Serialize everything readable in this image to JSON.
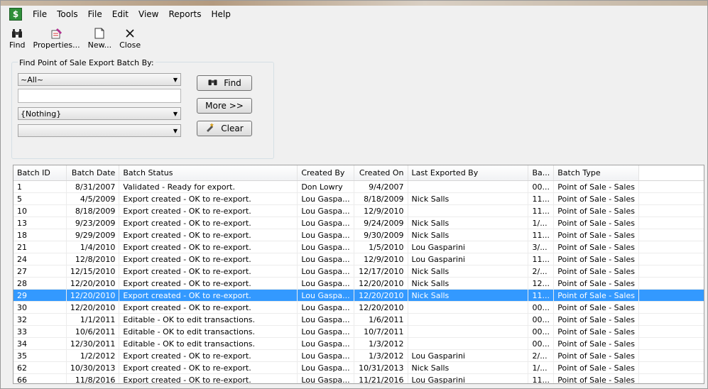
{
  "menu": [
    "File",
    "Tools",
    "File",
    "Edit",
    "View",
    "Reports",
    "Help"
  ],
  "toolbar": {
    "find": "Find",
    "properties": "Properties...",
    "new": "New...",
    "close": "Close"
  },
  "search": {
    "group_title": "Find Point of Sale Export Batch By:",
    "field1_value": "~All~",
    "text_value": "",
    "field2_value": "{Nothing}",
    "field3_value": "",
    "find_label": "Find",
    "more_label": "More >>",
    "clear_label": "Clear"
  },
  "table": {
    "columns": [
      "Batch ID",
      "Batch Date",
      "Batch Status",
      "Created By",
      "Created On",
      "Last Exported By",
      "Ba...",
      "Batch Type"
    ],
    "selected_index": 9,
    "rows": [
      [
        "1",
        "8/31/2007",
        "Validated - Ready for export.",
        "Don Lowry",
        "9/4/2007",
        "",
        "00...",
        "Point of Sale - Sales"
      ],
      [
        "5",
        "4/5/2009",
        "Export created - OK to re-export.",
        "Lou Gaspa...",
        "8/18/2009",
        "Nick Salls",
        "11...",
        "Point of Sale - Sales"
      ],
      [
        "10",
        "8/18/2009",
        "Export created - OK to re-export.",
        "Lou Gaspa...",
        "12/9/2010",
        "",
        "11...",
        "Point of Sale - Sales"
      ],
      [
        "13",
        "9/23/2009",
        "Export created - OK to re-export.",
        "Lou Gaspa...",
        "9/24/2009",
        "Nick Salls",
        "1/...",
        "Point of Sale - Sales"
      ],
      [
        "18",
        "9/29/2009",
        "Export created - OK to re-export.",
        "Lou Gaspa...",
        "9/30/2009",
        "Nick Salls",
        "11...",
        "Point of Sale - Sales"
      ],
      [
        "21",
        "1/4/2010",
        "Export created - OK to re-export.",
        "Lou Gaspa...",
        "1/5/2010",
        "Lou Gasparini",
        "3/...",
        "Point of Sale - Sales"
      ],
      [
        "24",
        "12/8/2010",
        "Export created - OK to re-export.",
        "Lou Gaspa...",
        "12/9/2010",
        "Lou Gasparini",
        "11...",
        "Point of Sale - Sales"
      ],
      [
        "27",
        "12/15/2010",
        "Export created - OK to re-export.",
        "Lou Gaspa...",
        "12/17/2010",
        "Nick Salls",
        "2/...",
        "Point of Sale - Sales"
      ],
      [
        "28",
        "12/20/2010",
        "Export created - OK to re-export.",
        "Lou Gaspa...",
        "12/20/2010",
        "Nick Salls",
        "12...",
        "Point of Sale - Sales"
      ],
      [
        "29",
        "12/20/2010",
        "Export created - OK to re-export.",
        "Lou Gaspa...",
        "12/20/2010",
        "Nick Salls",
        "11...",
        "Point of Sale - Sales"
      ],
      [
        "30",
        "12/20/2010",
        "Export created - OK to re-export.",
        "Lou Gaspa...",
        "12/20/2010",
        "",
        "00...",
        "Point of Sale - Sales"
      ],
      [
        "32",
        "1/1/2011",
        "Editable - OK to edit transactions.",
        "Lou Gaspa...",
        "1/6/2011",
        "",
        "00...",
        "Point of Sale - Sales"
      ],
      [
        "33",
        "10/6/2011",
        "Editable - OK to edit transactions.",
        "Lou Gaspa...",
        "10/7/2011",
        "",
        "00...",
        "Point of Sale - Sales"
      ],
      [
        "34",
        "12/30/2011",
        "Editable - OK to edit transactions.",
        "Lou Gaspa...",
        "1/3/2012",
        "",
        "00...",
        "Point of Sale - Sales"
      ],
      [
        "35",
        "1/2/2012",
        "Export created - OK to re-export.",
        "Lou Gaspa...",
        "1/3/2012",
        "Lou Gasparini",
        "2/...",
        "Point of Sale - Sales"
      ],
      [
        "62",
        "10/30/2013",
        "Export created - OK to re-export.",
        "Lou Gaspa...",
        "10/31/2013",
        "Nick Salls",
        "1/...",
        "Point of Sale - Sales"
      ],
      [
        "66",
        "11/8/2016",
        "Export created - OK to re-export.",
        "Lou Gaspa...",
        "11/21/2016",
        "Lou Gasparini",
        "11...",
        "Point of Sale - Sales"
      ]
    ]
  }
}
